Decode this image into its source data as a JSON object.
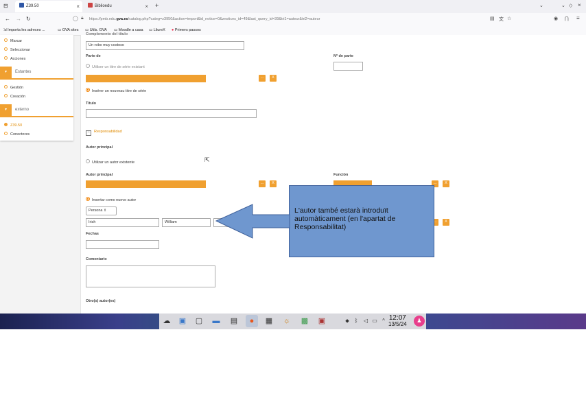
{
  "browser": {
    "tabs": [
      {
        "title": "Z39.50",
        "close": "×"
      },
      {
        "title": "Biblioedu",
        "close": "×"
      }
    ],
    "new_tab": "+",
    "url": {
      "prefix": "https://pmb.edu.",
      "domain": "gva.es",
      "path": "/catalog.php?categ=z3950&action=import&id_notice=0&znotices_id=49&last_query_id=39&tri1=auteur&tri2=auteur"
    },
    "bookmarks": [
      "Importa les adreces ...",
      "GVA sites",
      "Utils. GVA",
      "Moodle a casa",
      "LliureX",
      "Primers passos"
    ]
  },
  "sidebar": {
    "items_top": [
      "Marcar",
      "Seleccionar",
      "Acciones"
    ],
    "section1": "Estantes",
    "section1_items": [
      "Gestión",
      "Creación"
    ],
    "section2": "externo",
    "section2_items": [
      "Z39.50",
      "Conectores"
    ]
  },
  "form": {
    "top_label": "Complemento del título",
    "top_value": "Un robo muy costoso",
    "parte_de": "Parte de",
    "n_parte": "Nº de parte",
    "utiliser_serie": "Utiliser un titre de série existant",
    "inserer_serie": "Insérer un nouveau titre de série",
    "titulo": "Título",
    "responsabilidad": "Responsabilidad",
    "autor_principal": "Autor principal",
    "utilizar_autor": "Utilizar un autor existente",
    "autor_principal2": "Autor principal",
    "funcion": "Función",
    "insertar_autor": "Insertar como nuevo autor",
    "persona": "Persona",
    "apellido": "Irish",
    "nombre": "William",
    "fechas": "Fechas",
    "comentario": "Comentario",
    "otros": "Otro(s) autor(es)",
    "btn_dots": "...",
    "btn_x": "X"
  },
  "callout": {
    "text": "L'autor també estarà introduït automàticament (en l'apartat de Responsabilitat)"
  },
  "taskbar": {
    "time": "12:07",
    "date": "13/5/24"
  }
}
